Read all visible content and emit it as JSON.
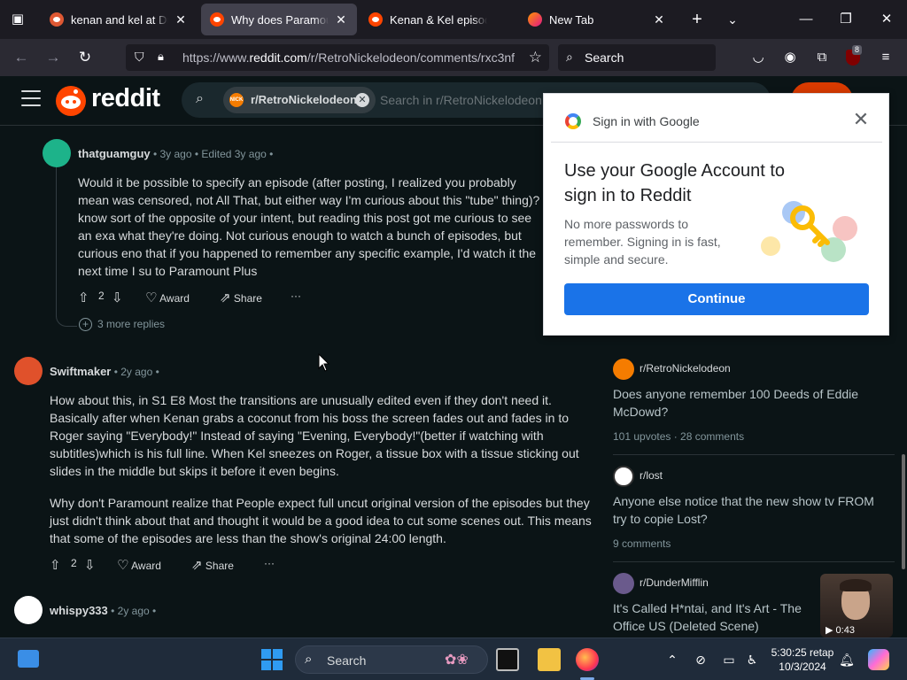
{
  "browser": {
    "tabs": [
      {
        "title": "kenan and kel at DuckDuckGo",
        "active": false,
        "icon": "duckduckgo-icon"
      },
      {
        "title": "Why does Paramount+ cut scenes",
        "active": true,
        "icon": "reddit-icon"
      },
      {
        "title": "Kenan & Kel episodes cut",
        "active": false,
        "icon": "reddit-icon"
      },
      {
        "title": "New Tab",
        "active": false,
        "icon": "firefox-icon"
      }
    ],
    "url_prefix": "https://www.",
    "url_host": "reddit.com",
    "url_path": "/r/RetroNickelodeon/comments/rxc3nf",
    "search_placeholder": "Search",
    "ublock_badge": "8"
  },
  "reddit": {
    "wordmark": "reddit",
    "search_chip": "r/RetroNickelodeon",
    "search_placeholder": "Search in r/RetroNickelodeon"
  },
  "comments": [
    {
      "user": "thatguamguy",
      "meta": "• 3y ago • Edited 3y ago •",
      "body": [
        "Would it be possible to specify an episode (after posting, I realized you probably mean was censored, not All That, but either way I'm curious about this \"tube\" thing)? I know sort of the opposite of your intent, but reading this post got me curious to see an exa what they're doing. Not curious enough to watch a bunch of episodes, but curious eno that if you happened to remember any specific example, I'd watch it the next time I su to Paramount Plus"
      ],
      "votes": "2",
      "award": "Award",
      "share": "Share",
      "more": "···"
    },
    {
      "user": "Swiftmaker",
      "meta": "• 2y ago •",
      "body": [
        "How about this, in S1 E8 Most the transitions are unusually edited even if they don't need it. Basically after when Kenan grabs a coconut from his boss the screen fades out and fades in to Roger saying \"Everybody!\" Instead of saying \"Evening, Everybody!\"(better if watching with subtitles)which is his full line. When Kel sneezes on Roger, a tissue box with a tissue sticking out slides in the middle but skips it before it even begins.",
        "Why don't Paramount realize that People expect full uncut original version of the episodes but they just didn't think about that and thought it would be a good idea to cut some scenes out. This means that some of the episodes are less than the show's original 24:00 length."
      ],
      "votes": "2",
      "award": "Award",
      "share": "Share",
      "more": "···"
    },
    {
      "user": "whispy333",
      "meta": "• 2y ago •"
    }
  ],
  "more_replies": "3 more replies",
  "related": [
    {
      "sub": "r/RetroNickelodeon",
      "title": "Does anyone remember 100 Deeds of Eddie McDowd?",
      "stats": "101 upvotes · 28 comments"
    },
    {
      "sub": "r/lost",
      "title": "Anyone else notice that the new show tv FROM try to copie Lost?",
      "stats": "9 comments"
    },
    {
      "sub": "r/DunderMifflin",
      "title": "It's Called H*ntai, and It's Art - The Office US (Deleted Scene)",
      "stats": "",
      "video_duration": "0:43"
    }
  ],
  "google_popup": {
    "header": "Sign in with Google",
    "title": "Use your Google Account to sign in to Reddit",
    "subtitle": "No more passwords to remember. Signing in is fast, simple and secure.",
    "button": "Continue"
  },
  "taskbar": {
    "search_placeholder": "Search",
    "time": "5:30:25 retap",
    "date": "10/3/2024"
  },
  "colors": {
    "reddit_bg": "#0b1416",
    "reddit_orange": "#ff4500",
    "google_blue": "#1a73e8"
  }
}
